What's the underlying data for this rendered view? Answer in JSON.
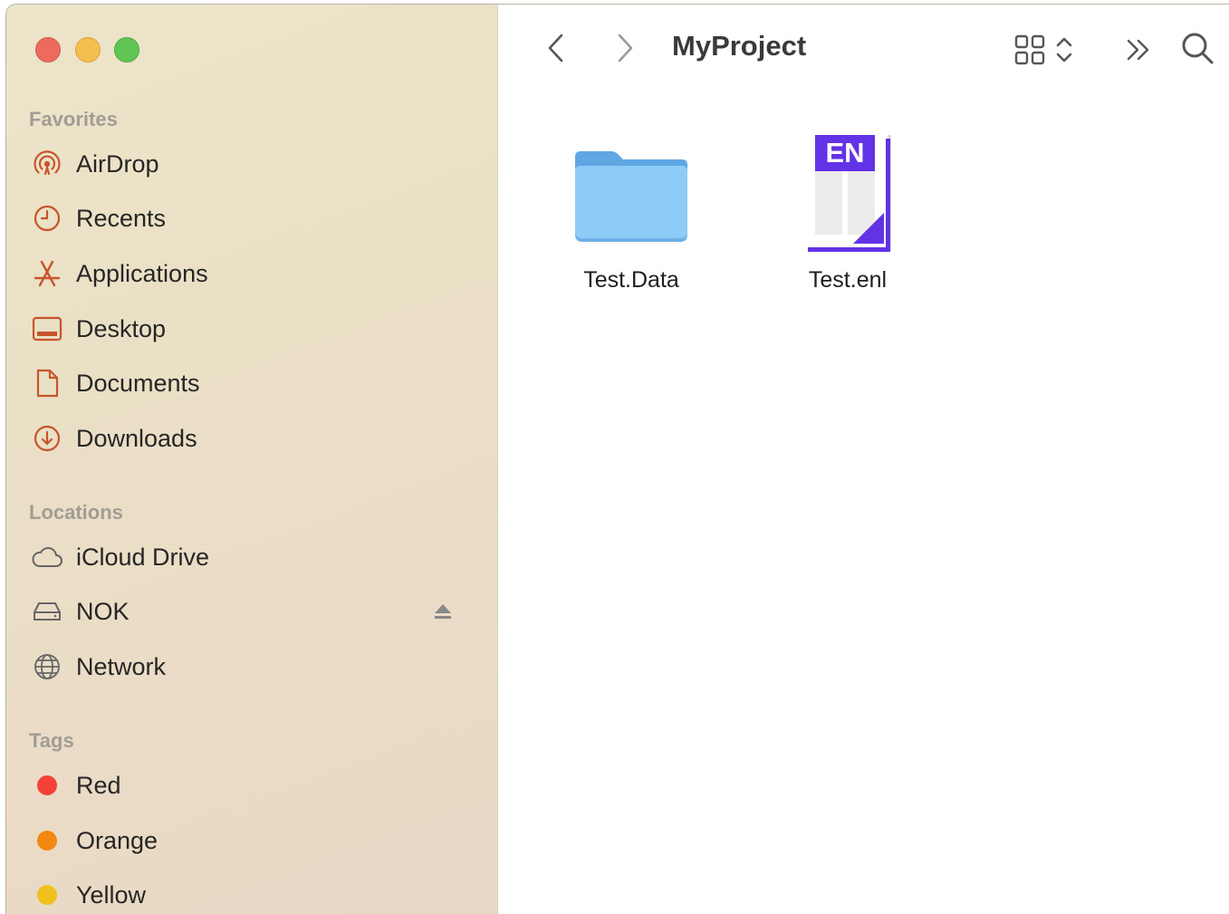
{
  "window": {
    "title": "MyProject"
  },
  "sidebar": {
    "favorites_header": "Favorites",
    "favorites": [
      {
        "label": "AirDrop",
        "icon": "airdrop-icon"
      },
      {
        "label": "Recents",
        "icon": "clock-icon"
      },
      {
        "label": "Applications",
        "icon": "applications-icon"
      },
      {
        "label": "Desktop",
        "icon": "desktop-icon"
      },
      {
        "label": "Documents",
        "icon": "document-icon"
      },
      {
        "label": "Downloads",
        "icon": "download-icon"
      }
    ],
    "locations_header": "Locations",
    "locations": [
      {
        "label": "iCloud Drive",
        "icon": "cloud-icon"
      },
      {
        "label": "NOK",
        "icon": "drive-icon",
        "ejectable": true
      },
      {
        "label": "Network",
        "icon": "globe-icon"
      }
    ],
    "tags_header": "Tags",
    "tags": [
      {
        "label": "Red",
        "color": "#f44236"
      },
      {
        "label": "Orange",
        "color": "#f3870f"
      },
      {
        "label": "Yellow",
        "color": "#f0c11d"
      }
    ]
  },
  "files": [
    {
      "name": "Test.Data",
      "icon": "folder-icon"
    },
    {
      "name": "Test.enl",
      "icon": "endnote-library-icon",
      "badge": "EN"
    }
  ],
  "colors": {
    "sidebar_icon": "#c8542b",
    "folder_blue": "#8ecbf6",
    "endnote_purple": "#6232e6"
  }
}
